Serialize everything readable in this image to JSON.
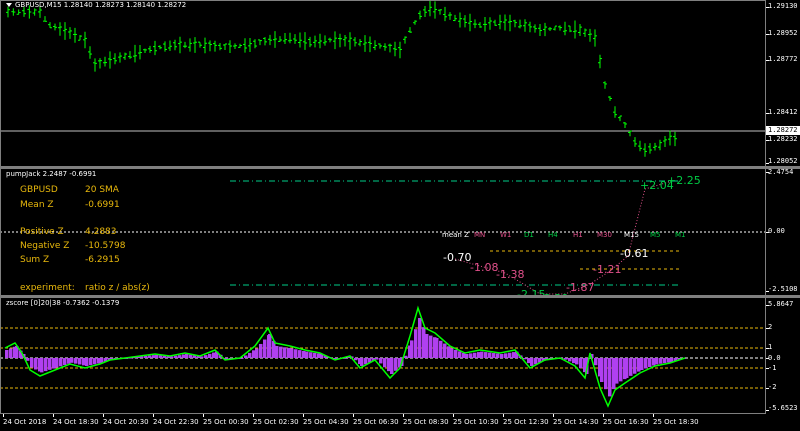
{
  "main_chart": {
    "title": "GBPUSD,M15  1.28140 1.28273 1.28140 1.28272",
    "price_labels": [
      "1.29130",
      "1.28952",
      "1.28772",
      "1.28412",
      "1.28232",
      "1.28052"
    ],
    "current_price": "1.28272",
    "bar_color": "#00ff00"
  },
  "pumpjack": {
    "title": "pumpJack 2.2487 -0.6991",
    "axis_labels": [
      "2.4754",
      "0.00",
      "-2.5108"
    ],
    "info": [
      {
        "label": "GBPUSD",
        "value": "20 SMA"
      },
      {
        "label": "Mean Z",
        "value": "-0.6991"
      },
      {
        "label": "Positive Z",
        "value": "4.2883"
      },
      {
        "label": "Negative Z",
        "value": "-10.5798"
      },
      {
        "label": "Sum Z",
        "value": "-6.2915"
      },
      {
        "label": "experiment:",
        "value": "ratio z / abs(z)"
      }
    ],
    "timeframes": [
      {
        "label": "mean Z",
        "color": "#ffffff"
      },
      {
        "label": "MN",
        "color": "#e0508a"
      },
      {
        "label": "W1",
        "color": "#e0508a"
      },
      {
        "label": "D1",
        "color": "#00cc44"
      },
      {
        "label": "H4",
        "color": "#00cc44"
      },
      {
        "label": "H1",
        "color": "#e0508a"
      },
      {
        "label": "M30",
        "color": "#e0508a"
      },
      {
        "label": "M15",
        "color": "#ffffff"
      },
      {
        "label": "M5",
        "color": "#00cc44"
      },
      {
        "label": "M1",
        "color": "#00cc44"
      }
    ],
    "z_values": [
      {
        "text": "-0.70",
        "color": "#ffffff"
      },
      {
        "text": "-1.08",
        "color": "#e0508a"
      },
      {
        "text": "-1.38",
        "color": "#e0508a"
      },
      {
        "text": "-2.15",
        "color": "#00cc44"
      },
      {
        "text": "-2.29",
        "color": "#00cc44"
      },
      {
        "text": "-1.87",
        "color": "#e0508a"
      },
      {
        "text": "-1.21",
        "color": "#e0508a"
      },
      {
        "text": "-0.61",
        "color": "#ffffff"
      },
      {
        "text": "+2.04",
        "color": "#00cc44"
      },
      {
        "text": "+2.25",
        "color": "#00cc44"
      }
    ]
  },
  "zscore": {
    "title": "zscore [0]20|38 -0.7362 -0.1379",
    "axis_labels": [
      "5.8647",
      "2",
      "1",
      "0.0",
      "-1",
      "-2",
      "-5.6523"
    ],
    "line_color": "#00ff00",
    "hist_color": "#b040f0"
  },
  "time_axis": [
    "24 Oct 2018",
    "24 Oct 18:30",
    "24 Oct 20:30",
    "24 Oct 22:30",
    "25 Oct 00:30",
    "25 Oct 02:30",
    "25 Oct 04:30",
    "25 Oct 06:30",
    "25 Oct 08:30",
    "25 Oct 10:30",
    "25 Oct 12:30",
    "25 Oct 14:30",
    "25 Oct 16:30",
    "25 Oct 18:30"
  ]
}
